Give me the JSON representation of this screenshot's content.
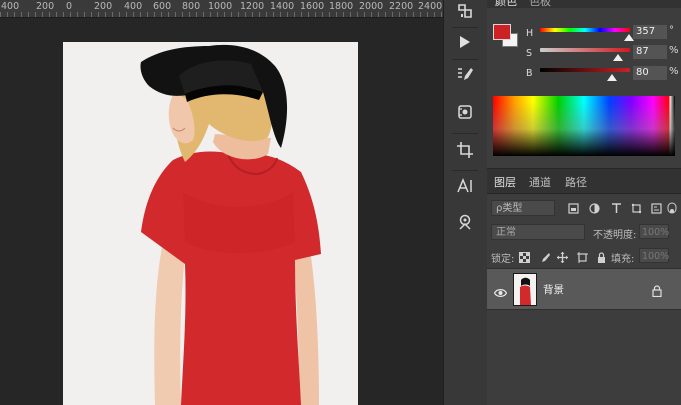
{
  "ruler": {
    "labels": [
      "400",
      "200",
      "0",
      "200",
      "400",
      "600",
      "800",
      "1000",
      "1200",
      "1400",
      "1600",
      "1800",
      "2000",
      "2200",
      "2400"
    ]
  },
  "tools": [
    {
      "name": "arrange-tool",
      "icon": "arrange-icon"
    },
    {
      "name": "play-action",
      "icon": "play-icon"
    },
    {
      "name": "brush-settings",
      "icon": "brush-settings-icon"
    },
    {
      "name": "properties-tool",
      "icon": "properties-icon"
    },
    {
      "name": "crop-tool",
      "icon": "crop-icon"
    },
    {
      "name": "character-tool",
      "icon": "character-icon"
    },
    {
      "name": "clone-source-tool",
      "icon": "clone-source-icon"
    }
  ],
  "color_panel": {
    "tab_color": "颜色",
    "tab_swatches": "色板",
    "foreground_color": "#cd2124",
    "background_color": "#f4f4f4",
    "sliders": [
      {
        "label": "H",
        "value": "357",
        "unit": "°",
        "thumb": 0.99,
        "gradient": "linear-gradient(to right,#ff0000,#ffff00,#00ff00,#00ffff,#0000ff,#ff00ff,#ff0000)"
      },
      {
        "label": "S",
        "value": "87",
        "unit": "%",
        "thumb": 0.87,
        "gradient": "linear-gradient(to right,#cccccc,#d01a1f)"
      },
      {
        "label": "B",
        "value": "80",
        "unit": "%",
        "thumb": 0.8,
        "gradient": "linear-gradient(to right,#000000,#cd2124)"
      }
    ]
  },
  "layers_panel": {
    "tabs": [
      "图层",
      "通道",
      "路径"
    ],
    "filter_label": "ρ类型",
    "blend_mode": "正常",
    "opacity_label": "不透明度:",
    "opacity_value": "100%",
    "lock_label": "锁定:",
    "fill_label": "填充:",
    "fill_value": "100%",
    "layers": [
      {
        "name": "背景",
        "visible": true,
        "locked": true
      }
    ]
  },
  "accent_color": "#cd2124"
}
